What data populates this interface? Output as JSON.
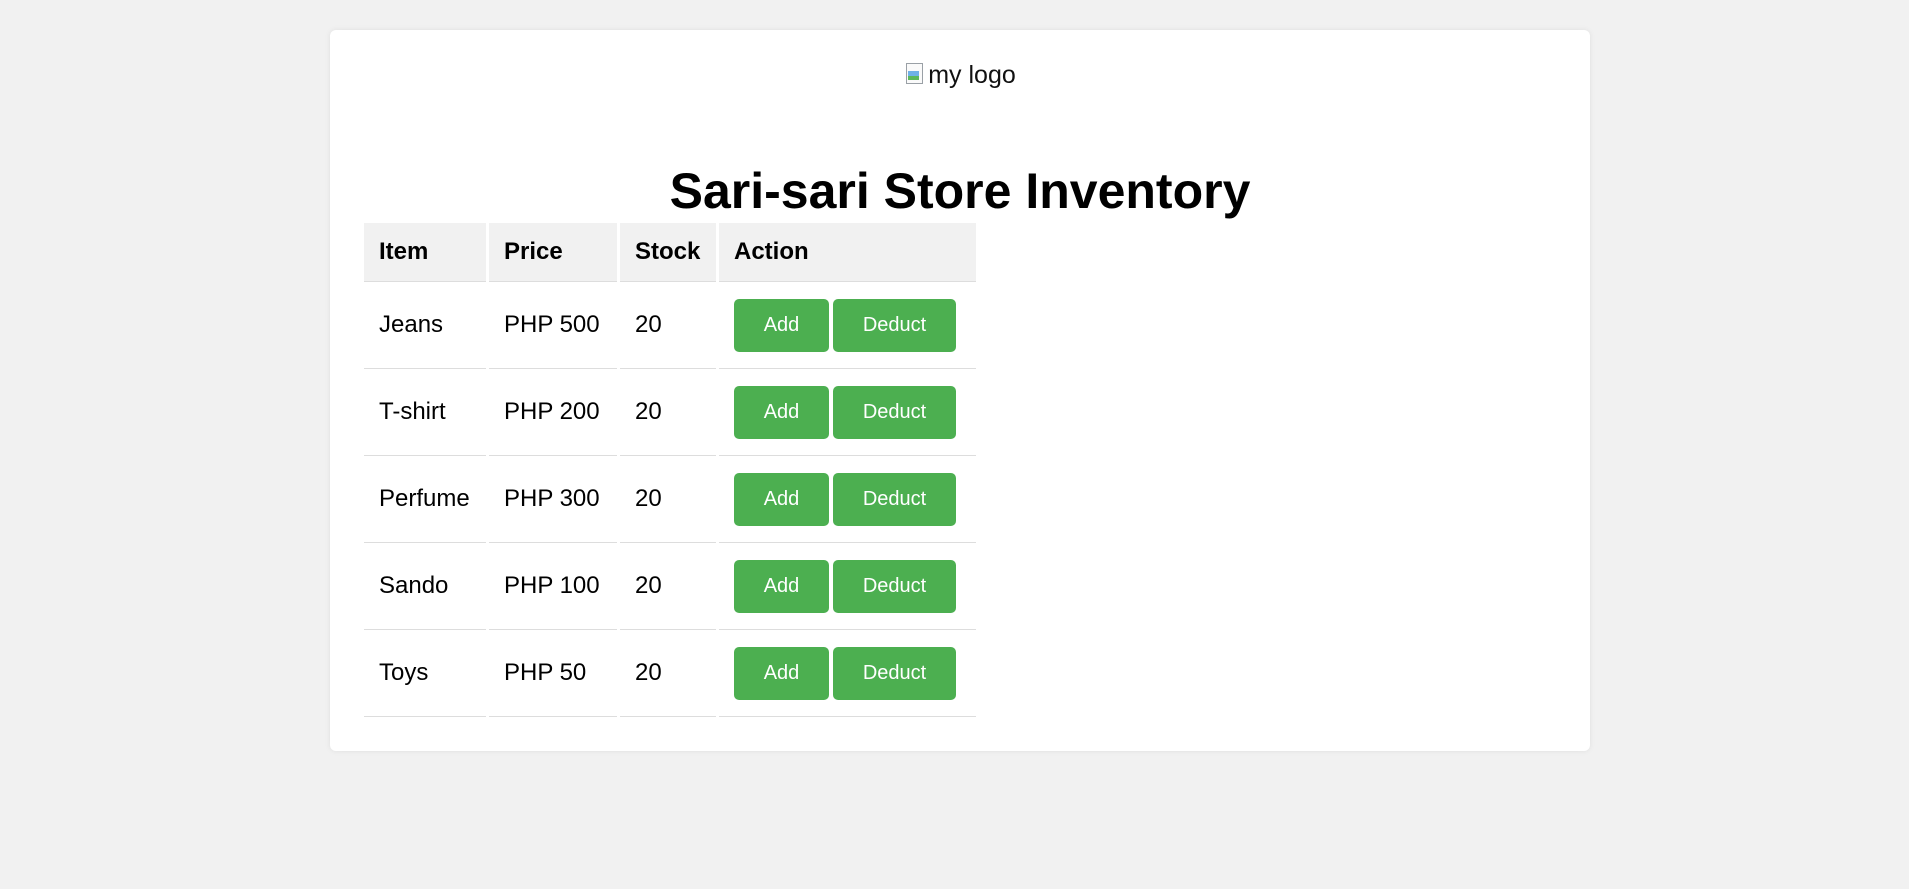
{
  "logo": {
    "alt_text": "my logo"
  },
  "page_title": "Sari-sari Store Inventory",
  "table": {
    "headers": [
      "Item",
      "Price",
      "Stock",
      "Action"
    ],
    "rows": [
      {
        "item": "Jeans",
        "price": "PHP 500",
        "stock": "20"
      },
      {
        "item": "T-shirt",
        "price": "PHP 200",
        "stock": "20"
      },
      {
        "item": "Perfume",
        "price": "PHP 300",
        "stock": "20"
      },
      {
        "item": "Sando",
        "price": "PHP 100",
        "stock": "20"
      },
      {
        "item": "Toys",
        "price": "PHP 50",
        "stock": "20"
      }
    ],
    "add_label": "Add",
    "deduct_label": "Deduct"
  },
  "colors": {
    "page_background": "#f1f1f1",
    "card_background": "#ffffff",
    "button_green": "#4caf50",
    "header_cell_background": "#f1f1f1"
  }
}
